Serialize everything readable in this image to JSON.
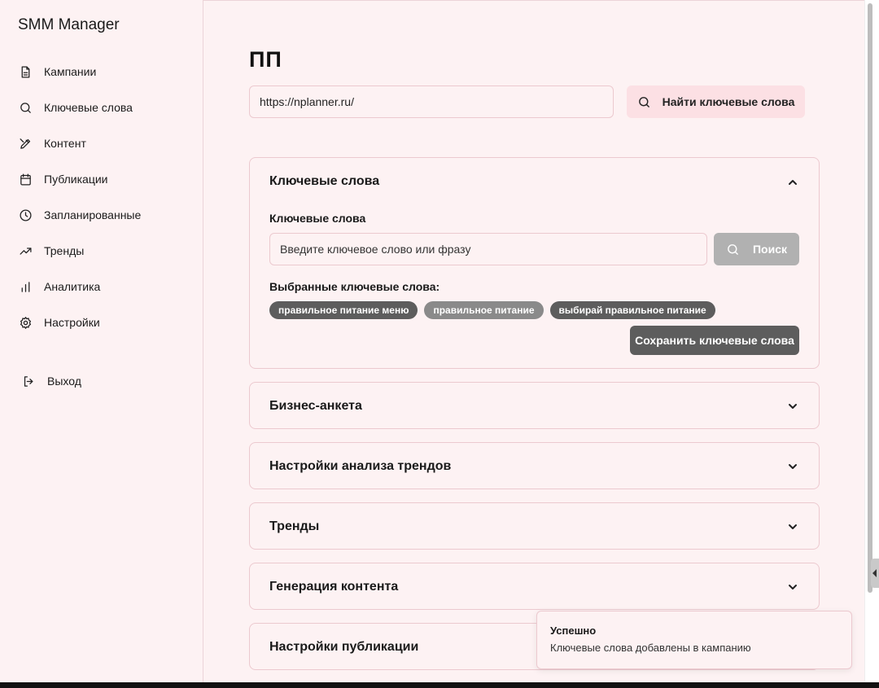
{
  "app": {
    "title": "SMM Manager"
  },
  "sidebar": {
    "items": [
      {
        "label": "Кампании",
        "icon": "document-icon"
      },
      {
        "label": "Ключевые слова",
        "icon": "search-icon"
      },
      {
        "label": "Контент",
        "icon": "pen-icon"
      },
      {
        "label": "Публикации",
        "icon": "calendar-icon"
      },
      {
        "label": "Запланированные",
        "icon": "clock-icon"
      },
      {
        "label": "Тренды",
        "icon": "trending-up-icon"
      },
      {
        "label": "Аналитика",
        "icon": "bar-chart-icon"
      },
      {
        "label": "Настройки",
        "icon": "gear-icon"
      }
    ],
    "logout": {
      "label": "Выход",
      "icon": "logout-icon"
    }
  },
  "main": {
    "page_title": "ПП",
    "url_input": {
      "value": "https://nplanner.ru/"
    },
    "find_button": {
      "label": "Найти ключевые слова",
      "icon": "search-icon"
    },
    "keywords_section": {
      "title": "Ключевые слова",
      "field_label": "Ключевые слова",
      "input_placeholder": "Введите ключевое слово или фразу",
      "search_button": "Поиск",
      "selected_label": "Выбранные ключевые слова:",
      "chips": [
        "правильное питание меню",
        "правильное питание",
        "выбирай правильное питание"
      ],
      "save_button": "Сохранить ключевые слова"
    },
    "sections": [
      "Бизнес-анкета",
      "Настройки анализа трендов",
      "Тренды",
      "Генерация контента",
      "Настройки публикации"
    ]
  },
  "toast": {
    "title": "Успешно",
    "message": "Ключевые слова добавлены в кампанию"
  },
  "colors": {
    "background": "#fdf2f3",
    "border": "#ecc9cf",
    "accent_button": "#fce0e4",
    "chip_dark": "#5d5d5d",
    "chip_light": "#8a8a8a",
    "disabled_button": "#b1b1b1"
  }
}
